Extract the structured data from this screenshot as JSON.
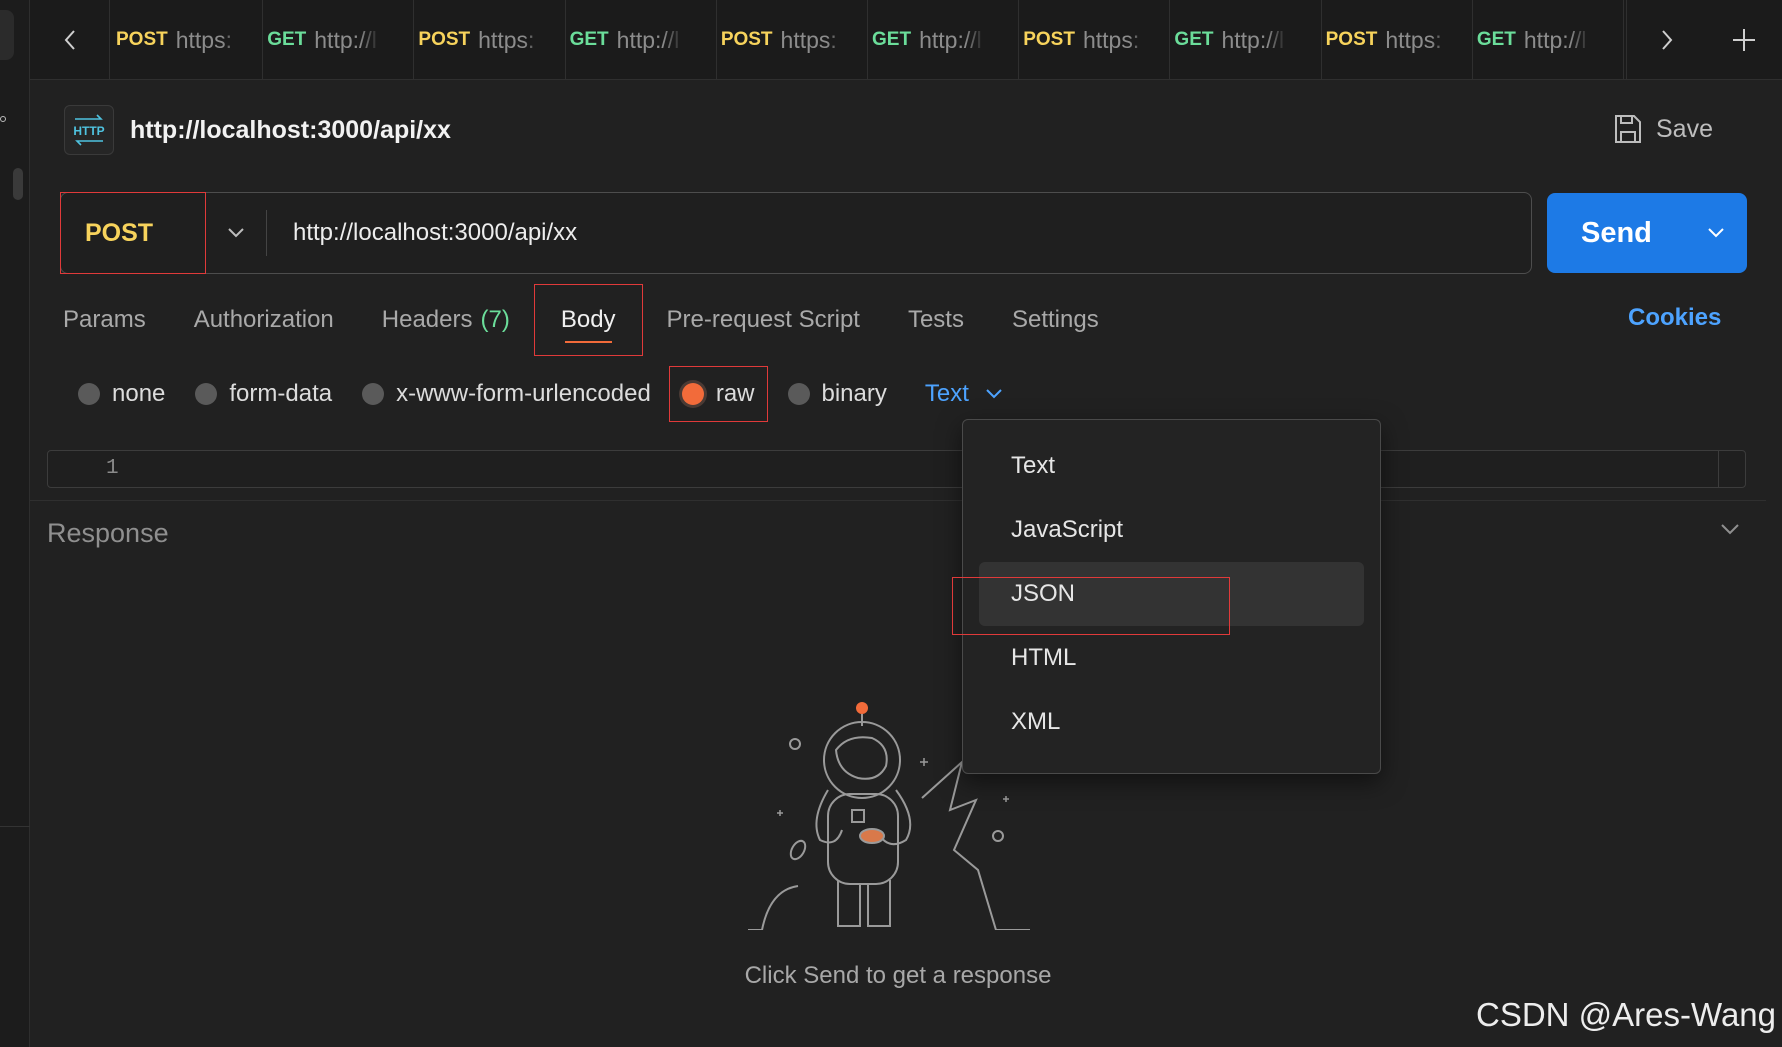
{
  "tabs": [
    {
      "method": "POST",
      "url": "https:",
      "kind": "post"
    },
    {
      "method": "GET",
      "url": "http://l",
      "kind": "get"
    },
    {
      "method": "POST",
      "url": "https:",
      "kind": "post"
    },
    {
      "method": "GET",
      "url": "http://l",
      "kind": "get"
    },
    {
      "method": "POST",
      "url": "https:",
      "kind": "post"
    },
    {
      "method": "GET",
      "url": "http://l",
      "kind": "get"
    },
    {
      "method": "POST",
      "url": "https:",
      "kind": "post"
    },
    {
      "method": "GET",
      "url": "http://l",
      "kind": "get"
    },
    {
      "method": "POST",
      "url": "https:",
      "kind": "post"
    },
    {
      "method": "GET",
      "url": "http://l",
      "kind": "get"
    }
  ],
  "header": {
    "badge": "HTTP",
    "title": "http://localhost:3000/api/xx",
    "save_label": "Save"
  },
  "request": {
    "method": "POST",
    "url": "http://localhost:3000/api/xx",
    "send_label": "Send"
  },
  "request_tabs": {
    "params": "Params",
    "authorization": "Authorization",
    "headers": "Headers",
    "headers_count": "(7)",
    "body": "Body",
    "prerequest": "Pre-request Script",
    "tests": "Tests",
    "settings": "Settings",
    "cookies": "Cookies"
  },
  "body_types": {
    "none": "none",
    "form_data": "form-data",
    "urlencoded": "x-www-form-urlencoded",
    "raw": "raw",
    "binary": "binary",
    "selected_format": "Text"
  },
  "editor": {
    "line_number": "1"
  },
  "format_dropdown": [
    "Text",
    "JavaScript",
    "JSON",
    "HTML",
    "XML"
  ],
  "response": {
    "title": "Response",
    "empty_message": "Click Send to get a response"
  },
  "watermark": "CSDN @Ares-Wang",
  "colors": {
    "post": "#f7d35c",
    "get": "#6bdd9a",
    "send": "#1d7ae6",
    "accent": "#f26b3a",
    "link": "#4da3ff",
    "highlight_border": "#e03a3a"
  }
}
